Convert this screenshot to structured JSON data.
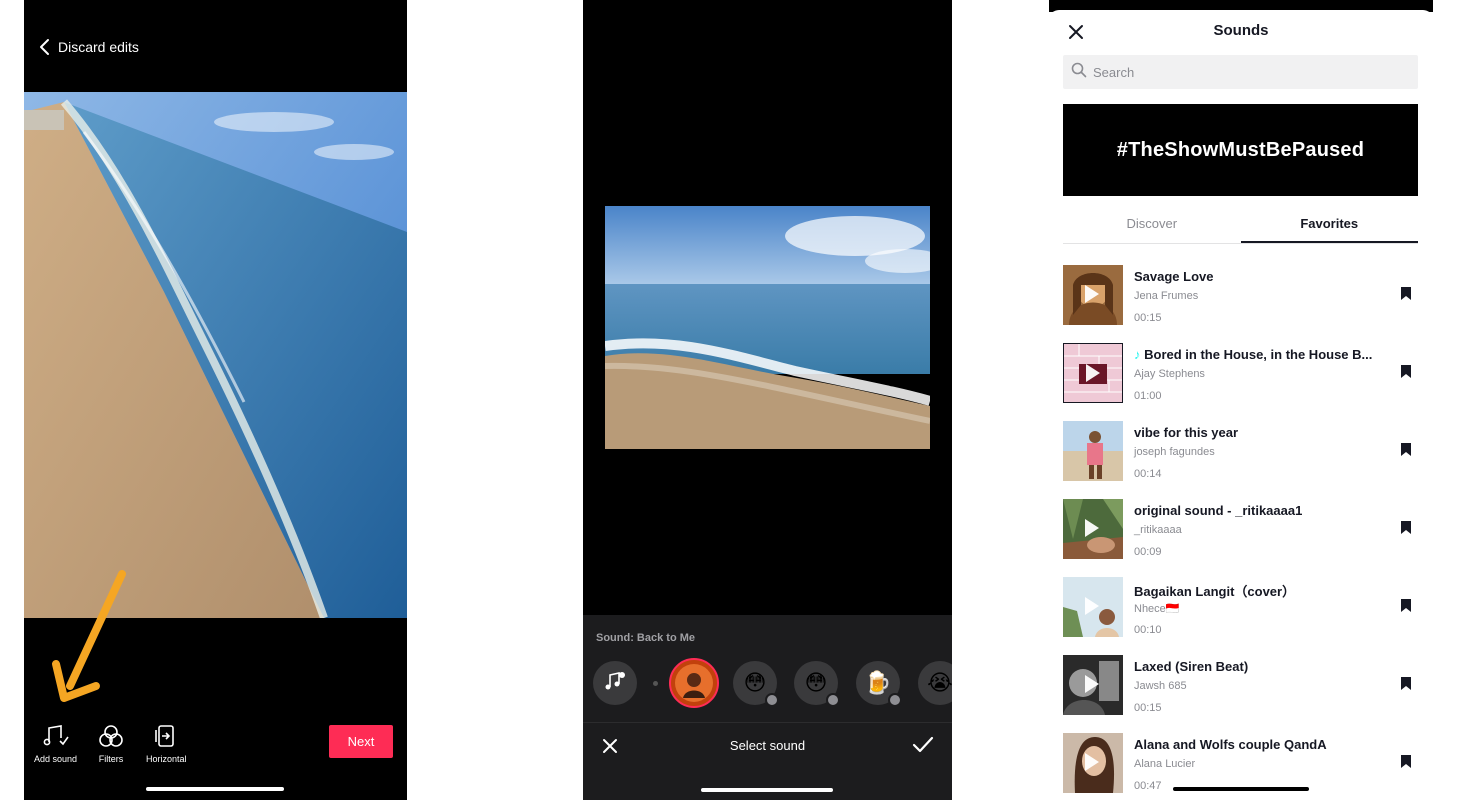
{
  "editor": {
    "back_label": "Discard edits",
    "tools": [
      {
        "label": "Add sound",
        "icon": "music-note-icon"
      },
      {
        "label": "Filters",
        "icon": "filters-icon"
      },
      {
        "label": "Horizontal",
        "icon": "horizontal-icon"
      }
    ],
    "next_label": "Next",
    "accent_color": "#fe2c55",
    "annotation_arrow_color": "#f5a623"
  },
  "sound_picker": {
    "current_sound": "Sound: Back to Me",
    "title": "Select sound",
    "circle_icons": [
      "music-library-icon",
      "sound-avatar",
      "sunglasses-emoji-icon",
      "glasses-emoji-icon",
      "beer-emoji-icon",
      "crying-emoji-icon"
    ]
  },
  "sounds": {
    "title": "Sounds",
    "search_placeholder": "Search",
    "banner": "#TheShowMustBePaused",
    "tabs": [
      "Discover",
      "Favorites"
    ],
    "active_tab": "Favorites",
    "items": [
      {
        "title": "Savage Love",
        "artist": "Jena Frumes",
        "duration": "00:15"
      },
      {
        "title": "Bored in the House, in the House B...",
        "artist": "Ajay Stephens",
        "duration": "01:00",
        "badge": "tiktok-note-icon"
      },
      {
        "title": "vibe for this year",
        "artist": "joseph fagundes",
        "duration": "00:14"
      },
      {
        "title": "original sound - _ritikaaaa1",
        "artist": "_ritikaaaa",
        "duration": "00:09"
      },
      {
        "title": "Bagaikan Langit（cover）",
        "artist": "Nhece🇮🇩",
        "duration": "00:10"
      },
      {
        "title": "Laxed (Siren Beat)",
        "artist": "Jawsh 685",
        "duration": "00:15"
      },
      {
        "title": "Alana and Wolfs couple QandA",
        "artist": "Alana Lucier",
        "duration": "00:47"
      }
    ]
  }
}
